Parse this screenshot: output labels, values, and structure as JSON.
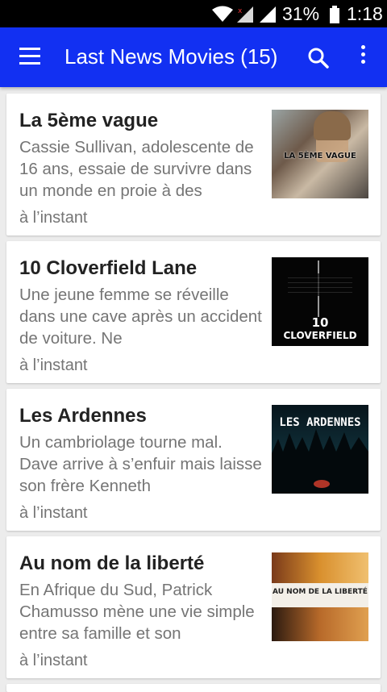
{
  "status_bar": {
    "battery_percent": "31%",
    "time": "1:18",
    "icons": [
      "wifi-icon",
      "signal-icon",
      "signal-icon",
      "battery-icon"
    ]
  },
  "app_bar": {
    "title": "Last News Movies (15)",
    "icons": [
      "menu-icon",
      "search-icon",
      "overflow-menu-icon"
    ]
  },
  "items": [
    {
      "title": "La 5ème vague",
      "description": "Cassie Sullivan, adolescente de 16 ans, essaie de survivre dans un monde en proie à des",
      "time": "à l’instant",
      "poster_text": [
        "LA 5ÈME VAGUE"
      ]
    },
    {
      "title": "10 Cloverfield Lane",
      "description": "Une jeune femme se réveille dans une cave après un accident de voiture. Ne",
      "time": "à l’instant",
      "poster_text": [
        "10",
        "CLOVERFIELD"
      ]
    },
    {
      "title": "Les Ardennes",
      "description": "Un cambriolage tourne mal. Dave arrive à s’enfuir mais laisse son frère Kenneth",
      "time": "à l’instant",
      "poster_text": [
        "LES ARDENNES"
      ]
    },
    {
      "title": "Au nom de la liberté",
      "description": "En Afrique du Sud, Patrick Chamusso mène une vie simple entre sa famille et son",
      "time": "à l’instant",
      "poster_text": [
        "AU NOM DE LA LIBERTÉ"
      ]
    }
  ]
}
